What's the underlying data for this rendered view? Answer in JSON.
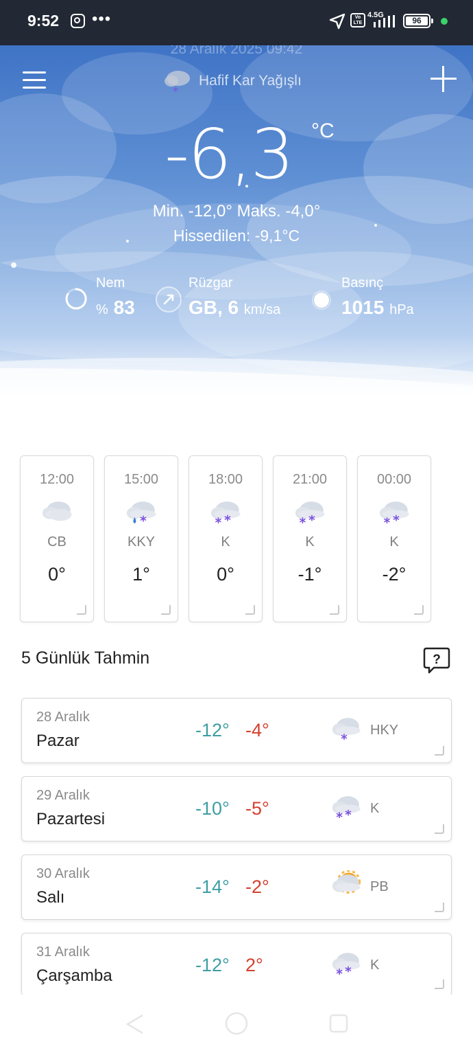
{
  "status_bar": {
    "time": "9:52",
    "network": "4.5G",
    "volte": "Vo LTE",
    "battery": "96"
  },
  "header": {
    "faded_date": "28 Aralık 2025 09:42",
    "condition": "Hafif Kar Yağışlı"
  },
  "current": {
    "temperature": "-6,3",
    "unit": "°C",
    "min_max": "Min. -12,0°  Maks. -4,0°",
    "feels_like": "Hissedilen: -9,1°C"
  },
  "stats": {
    "humidity": {
      "label": "Nem",
      "prefix": "%",
      "value": "83"
    },
    "wind": {
      "label": "Rüzgar",
      "value": "GB, 6",
      "unit": "km/sa"
    },
    "pressure": {
      "label": "Basınç",
      "value": "1015",
      "unit": "hPa"
    }
  },
  "hourly": [
    {
      "time": "12:00",
      "dir": "CB",
      "temp": "0°",
      "icon": "cloudy-icon"
    },
    {
      "time": "15:00",
      "dir": "KKY",
      "temp": "1°",
      "icon": "rain-snow-icon"
    },
    {
      "time": "18:00",
      "dir": "K",
      "temp": "0°",
      "icon": "snow-icon"
    },
    {
      "time": "21:00",
      "dir": "K",
      "temp": "-1°",
      "icon": "snow-icon"
    },
    {
      "time": "00:00",
      "dir": "K",
      "temp": "-2°",
      "icon": "snow-icon"
    }
  ],
  "forecast_title": "5 Günlük Tahmin",
  "daily": [
    {
      "date": "28 Aralık",
      "day": "Pazar",
      "min": "-12°",
      "max": "-4°",
      "cond": "HKY",
      "icon": "light-snow-icon"
    },
    {
      "date": "29 Aralık",
      "day": "Pazartesi",
      "min": "-10°",
      "max": "-5°",
      "cond": "K",
      "icon": "snow-icon"
    },
    {
      "date": "30 Aralık",
      "day": "Salı",
      "min": "-14°",
      "max": "-2°",
      "cond": "PB",
      "icon": "partly-cloudy-icon"
    },
    {
      "date": "31 Aralık",
      "day": "Çarşamba",
      "min": "-12°",
      "max": "2°",
      "cond": "K",
      "icon": "snow-icon"
    }
  ],
  "colors": {
    "min_temp": "#3e9ea3",
    "max_temp": "#d4402f",
    "snow": "#7b4fe0",
    "status_bar": "#222834"
  }
}
